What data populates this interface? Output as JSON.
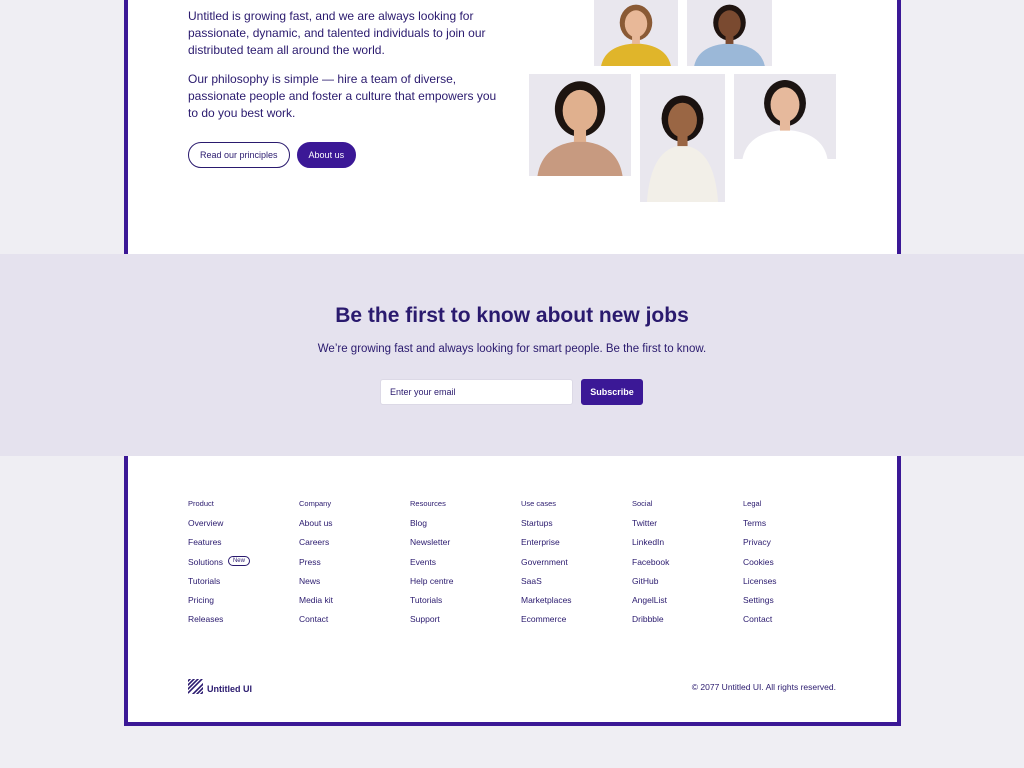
{
  "hero": {
    "paragraph1": "Untitled is growing fast, and we are always looking for passionate, dynamic, and talented individuals to join our distributed team all around the world.",
    "paragraph2": "Our philosophy is simple — hire a team of diverse, passionate people and foster a culture that empowers you to do you best work.",
    "button_principles": "Read our principles",
    "button_about": "About us"
  },
  "team_photos": [
    {
      "icon": "person-photo",
      "bg": "#e9e7ee",
      "shirt": "#e0b52a",
      "skin": "#e8b898",
      "hair": "#8a5a35"
    },
    {
      "icon": "person-photo",
      "bg": "#e9e7ee",
      "shirt": "#9bb8d8",
      "skin": "#7a4a30",
      "hair": "#1f1410"
    },
    {
      "icon": "person-photo",
      "bg": "#e9e7ee",
      "shirt": "#c79a80",
      "skin": "#e0b08e",
      "hair": "#1d1410"
    },
    {
      "icon": "person-photo",
      "bg": "#e9e7ee",
      "shirt": "#f2efe8",
      "skin": "#9a6644",
      "hair": "#1a1210"
    },
    {
      "icon": "person-photo",
      "bg": "#e9e7ee",
      "shirt": "#ffffff",
      "skin": "#e6b99c",
      "hair": "#1b1412"
    }
  ],
  "newsletter": {
    "title": "Be the first to know about new jobs",
    "subtitle": "We’re growing fast and always looking for smart people. Be the first to know.",
    "email_placeholder": "Enter your email",
    "subscribe_label": "Subscribe"
  },
  "footer": {
    "columns": [
      {
        "heading": "Product",
        "links": [
          "Overview",
          "Features",
          "Solutions",
          "Tutorials",
          "Pricing",
          "Releases"
        ]
      },
      {
        "heading": "Company",
        "links": [
          "About us",
          "Careers",
          "Press",
          "News",
          "Media kit",
          "Contact"
        ]
      },
      {
        "heading": "Resources",
        "links": [
          "Blog",
          "Newsletter",
          "Events",
          "Help centre",
          "Tutorials",
          "Support"
        ]
      },
      {
        "heading": "Use cases",
        "links": [
          "Startups",
          "Enterprise",
          "Government",
          "SaaS",
          "Marketplaces",
          "Ecommerce"
        ]
      },
      {
        "heading": "Social",
        "links": [
          "Twitter",
          "LinkedIn",
          "Facebook",
          "GitHub",
          "AngelList",
          "Dribbble"
        ]
      },
      {
        "heading": "Legal",
        "links": [
          "Terms",
          "Privacy",
          "Cookies",
          "Licenses",
          "Settings",
          "Contact"
        ]
      }
    ],
    "new_badge": "New",
    "brand_name": "Untitled UI",
    "brand_icon": "striped-logo-icon",
    "copyright": "© 2077 Untitled UI. All rights reserved."
  },
  "colors": {
    "brand": "#3b1896",
    "text": "#2a1a6e",
    "band": "#e5e2ee",
    "page_bg": "#efeef3"
  }
}
